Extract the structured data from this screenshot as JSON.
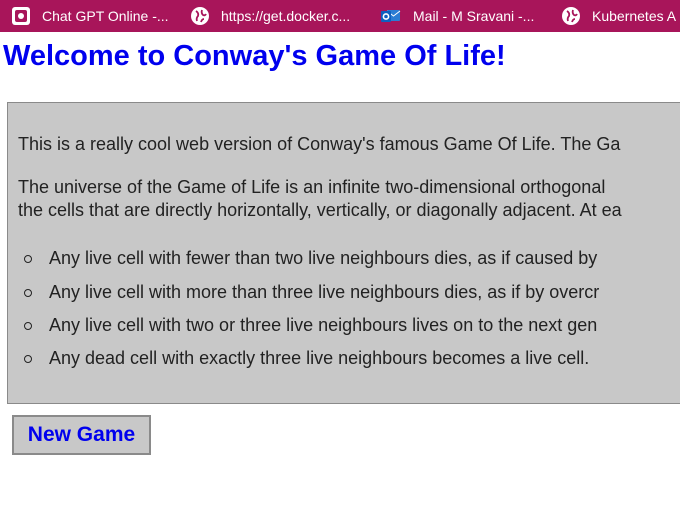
{
  "bookmarks": [
    {
      "label": "Chat GPT Online -...",
      "icon": "chat-app-icon"
    },
    {
      "label": "https://get.docker.c...",
      "icon": "globe-icon"
    },
    {
      "label": "Mail - M Sravani -...",
      "icon": "outlook-mail-icon"
    },
    {
      "label": "Kubernetes A",
      "icon": "globe-icon"
    }
  ],
  "page": {
    "title": "Welcome to Conway's Game Of Life!"
  },
  "intro": {
    "paragraph1": "This is a really cool web version of Conway's famous Game Of Life. The Ga",
    "paragraph2_line1": "The universe of the Game of Life is an infinite two-dimensional orthogonal",
    "paragraph2_line2": "the cells that are directly horizontally, vertically, or diagonally adjacent. At ea",
    "rules": [
      "Any live cell with fewer than two live neighbours dies, as if caused by",
      "Any live cell with more than three live neighbours dies, as if by overcr",
      "Any live cell with two or three live neighbours lives on to the next gen",
      "Any dead cell with exactly three live neighbours becomes a live cell."
    ]
  },
  "actions": {
    "new_game_label": "New Game"
  },
  "colors": {
    "bookmarks_bar": "#a8155a",
    "title": "#0000ee",
    "panel_background": "#c8c8c8",
    "button_text": "#0000ee"
  }
}
